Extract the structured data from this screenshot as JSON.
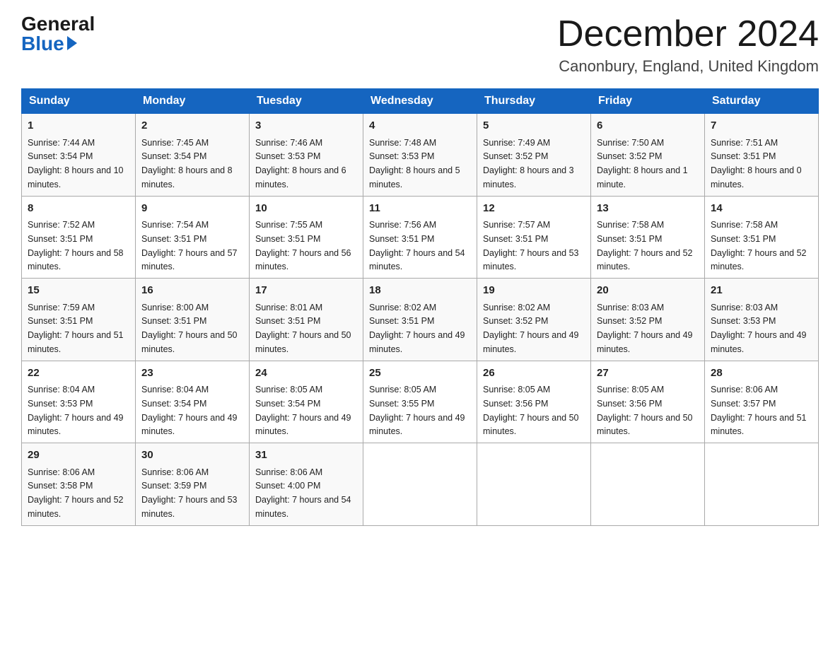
{
  "logo": {
    "general": "General",
    "blue": "Blue"
  },
  "title": "December 2024",
  "location": "Canonbury, England, United Kingdom",
  "days_header": [
    "Sunday",
    "Monday",
    "Tuesday",
    "Wednesday",
    "Thursday",
    "Friday",
    "Saturday"
  ],
  "weeks": [
    [
      {
        "num": "1",
        "sunrise": "7:44 AM",
        "sunset": "3:54 PM",
        "daylight": "8 hours and 10 minutes."
      },
      {
        "num": "2",
        "sunrise": "7:45 AM",
        "sunset": "3:54 PM",
        "daylight": "8 hours and 8 minutes."
      },
      {
        "num": "3",
        "sunrise": "7:46 AM",
        "sunset": "3:53 PM",
        "daylight": "8 hours and 6 minutes."
      },
      {
        "num": "4",
        "sunrise": "7:48 AM",
        "sunset": "3:53 PM",
        "daylight": "8 hours and 5 minutes."
      },
      {
        "num": "5",
        "sunrise": "7:49 AM",
        "sunset": "3:52 PM",
        "daylight": "8 hours and 3 minutes."
      },
      {
        "num": "6",
        "sunrise": "7:50 AM",
        "sunset": "3:52 PM",
        "daylight": "8 hours and 1 minute."
      },
      {
        "num": "7",
        "sunrise": "7:51 AM",
        "sunset": "3:51 PM",
        "daylight": "8 hours and 0 minutes."
      }
    ],
    [
      {
        "num": "8",
        "sunrise": "7:52 AM",
        "sunset": "3:51 PM",
        "daylight": "7 hours and 58 minutes."
      },
      {
        "num": "9",
        "sunrise": "7:54 AM",
        "sunset": "3:51 PM",
        "daylight": "7 hours and 57 minutes."
      },
      {
        "num": "10",
        "sunrise": "7:55 AM",
        "sunset": "3:51 PM",
        "daylight": "7 hours and 56 minutes."
      },
      {
        "num": "11",
        "sunrise": "7:56 AM",
        "sunset": "3:51 PM",
        "daylight": "7 hours and 54 minutes."
      },
      {
        "num": "12",
        "sunrise": "7:57 AM",
        "sunset": "3:51 PM",
        "daylight": "7 hours and 53 minutes."
      },
      {
        "num": "13",
        "sunrise": "7:58 AM",
        "sunset": "3:51 PM",
        "daylight": "7 hours and 52 minutes."
      },
      {
        "num": "14",
        "sunrise": "7:58 AM",
        "sunset": "3:51 PM",
        "daylight": "7 hours and 52 minutes."
      }
    ],
    [
      {
        "num": "15",
        "sunrise": "7:59 AM",
        "sunset": "3:51 PM",
        "daylight": "7 hours and 51 minutes."
      },
      {
        "num": "16",
        "sunrise": "8:00 AM",
        "sunset": "3:51 PM",
        "daylight": "7 hours and 50 minutes."
      },
      {
        "num": "17",
        "sunrise": "8:01 AM",
        "sunset": "3:51 PM",
        "daylight": "7 hours and 50 minutes."
      },
      {
        "num": "18",
        "sunrise": "8:02 AM",
        "sunset": "3:51 PM",
        "daylight": "7 hours and 49 minutes."
      },
      {
        "num": "19",
        "sunrise": "8:02 AM",
        "sunset": "3:52 PM",
        "daylight": "7 hours and 49 minutes."
      },
      {
        "num": "20",
        "sunrise": "8:03 AM",
        "sunset": "3:52 PM",
        "daylight": "7 hours and 49 minutes."
      },
      {
        "num": "21",
        "sunrise": "8:03 AM",
        "sunset": "3:53 PM",
        "daylight": "7 hours and 49 minutes."
      }
    ],
    [
      {
        "num": "22",
        "sunrise": "8:04 AM",
        "sunset": "3:53 PM",
        "daylight": "7 hours and 49 minutes."
      },
      {
        "num": "23",
        "sunrise": "8:04 AM",
        "sunset": "3:54 PM",
        "daylight": "7 hours and 49 minutes."
      },
      {
        "num": "24",
        "sunrise": "8:05 AM",
        "sunset": "3:54 PM",
        "daylight": "7 hours and 49 minutes."
      },
      {
        "num": "25",
        "sunrise": "8:05 AM",
        "sunset": "3:55 PM",
        "daylight": "7 hours and 49 minutes."
      },
      {
        "num": "26",
        "sunrise": "8:05 AM",
        "sunset": "3:56 PM",
        "daylight": "7 hours and 50 minutes."
      },
      {
        "num": "27",
        "sunrise": "8:05 AM",
        "sunset": "3:56 PM",
        "daylight": "7 hours and 50 minutes."
      },
      {
        "num": "28",
        "sunrise": "8:06 AM",
        "sunset": "3:57 PM",
        "daylight": "7 hours and 51 minutes."
      }
    ],
    [
      {
        "num": "29",
        "sunrise": "8:06 AM",
        "sunset": "3:58 PM",
        "daylight": "7 hours and 52 minutes."
      },
      {
        "num": "30",
        "sunrise": "8:06 AM",
        "sunset": "3:59 PM",
        "daylight": "7 hours and 53 minutes."
      },
      {
        "num": "31",
        "sunrise": "8:06 AM",
        "sunset": "4:00 PM",
        "daylight": "7 hours and 54 minutes."
      },
      null,
      null,
      null,
      null
    ]
  ],
  "labels": {
    "sunrise": "Sunrise:",
    "sunset": "Sunset:",
    "daylight": "Daylight:"
  }
}
